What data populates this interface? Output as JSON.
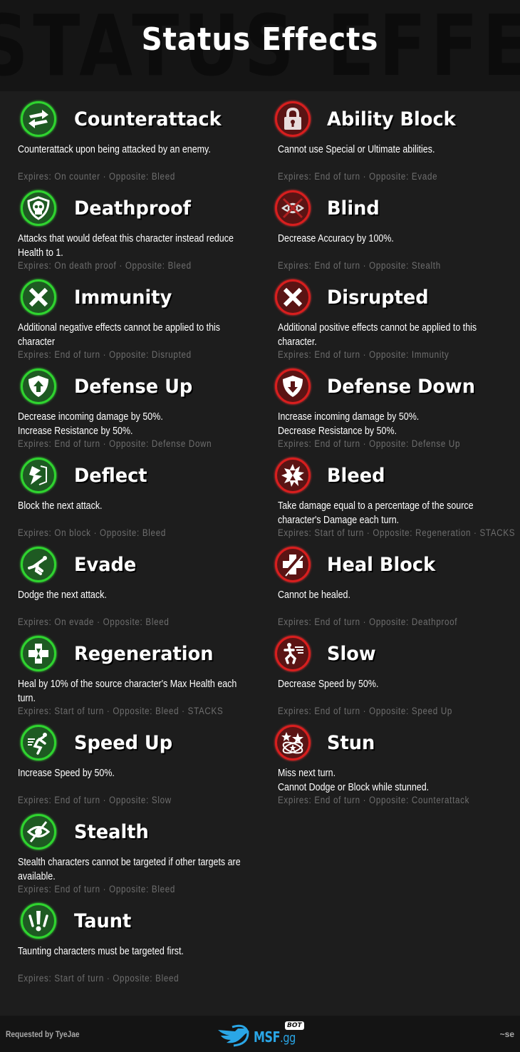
{
  "header": {
    "bg_text": "STATUS EFFECTS",
    "title": "Status Effects"
  },
  "effects_left": [
    {
      "name": "Counterattack",
      "icon": "swap-arrows-icon",
      "type": "buff",
      "description": "Counterattack upon being attacked by an enemy.",
      "meta": "Expires: On counter · Opposite: Bleed"
    },
    {
      "name": "Deathproof",
      "icon": "skull-shield-icon",
      "type": "buff",
      "description": "Attacks that would defeat this character instead reduce\nHealth to 1.",
      "meta": "Expires: On death proof · Opposite: Bleed"
    },
    {
      "name": "Immunity",
      "icon": "x-icon",
      "type": "buff",
      "description": "Additional negative effects cannot be applied to this\ncharacter",
      "meta": "Expires: End of turn · Opposite: Disrupted"
    },
    {
      "name": "Defense Up",
      "icon": "shield-up-icon",
      "type": "buff",
      "description": "Decrease incoming damage by 50%.\nIncrease Resistance by 50%.",
      "meta": "Expires: End of turn · Opposite: Defense Down"
    },
    {
      "name": "Deflect",
      "icon": "deflect-icon",
      "type": "buff",
      "description": "Block the next attack.",
      "meta": "Expires: On block · Opposite: Bleed"
    },
    {
      "name": "Evade",
      "icon": "evade-figure-icon",
      "type": "buff",
      "description": "Dodge the next attack.",
      "meta": "Expires: On evade · Opposite: Bleed"
    },
    {
      "name": "Regeneration",
      "icon": "cross-hourglass-icon",
      "type": "buff",
      "description": "Heal by 10% of the source character's Max Health each\nturn.",
      "meta": "Expires: Start of turn · Opposite: Bleed · STACKS"
    },
    {
      "name": "Speed Up",
      "icon": "running-figure-icon",
      "type": "buff",
      "description": "Increase Speed by 50%.",
      "meta": "Expires: End of turn · Opposite: Slow"
    },
    {
      "name": "Stealth",
      "icon": "eye-slash-icon",
      "type": "buff",
      "description": "Stealth characters cannot be targeted if other targets are\navailable.",
      "meta": "Expires: End of turn · Opposite: Bleed"
    },
    {
      "name": "Taunt",
      "icon": "exclamation-icon",
      "type": "buff",
      "description": "Taunting characters must be targeted first.",
      "meta": "Expires: Start of turn · Opposite: Bleed"
    }
  ],
  "effects_right": [
    {
      "name": "Ability Block",
      "icon": "padlock-icon",
      "type": "debuff",
      "description": "Cannot use Special or Ultimate abilities.",
      "meta": "Expires: End of turn · Opposite: Evade"
    },
    {
      "name": "Blind",
      "icon": "crossed-eye-icon",
      "type": "debuff",
      "description": "Decrease Accuracy by 100%.",
      "meta": "Expires: End of turn · Opposite: Stealth"
    },
    {
      "name": "Disrupted",
      "icon": "x-icon",
      "type": "debuff",
      "description": "Additional positive effects cannot be applied to this\ncharacter.",
      "meta": "Expires: End of turn · Opposite: Immunity"
    },
    {
      "name": "Defense Down",
      "icon": "shield-down-icon",
      "type": "debuff",
      "description": "Increase incoming damage by 50%.\nDecrease Resistance by 50%.",
      "meta": "Expires: End of turn · Opposite: Defense Up"
    },
    {
      "name": "Bleed",
      "icon": "burst-hourglass-icon",
      "type": "debuff",
      "description": "Take damage equal to a percentage of the source\ncharacter's Damage each turn.",
      "meta": "Expires: Start of turn · Opposite: Regeneration · STACKS"
    },
    {
      "name": "Heal Block",
      "icon": "crossed-cross-icon",
      "type": "debuff",
      "description": "Cannot be healed.",
      "meta": "Expires: End of turn · Opposite: Deathproof"
    },
    {
      "name": "Slow",
      "icon": "slow-figure-icon",
      "type": "debuff",
      "description": "Decrease Speed by 50%.",
      "meta": "Expires: End of turn · Opposite: Speed Up"
    },
    {
      "name": "Stun",
      "icon": "stars-orbit-icon",
      "type": "debuff",
      "description": "Miss next turn.\nCannot Dodge or Block while stunned.",
      "meta": "Expires: End of turn · Opposite: Counterattack"
    }
  ],
  "footer": {
    "requested_by": "Requested by TyeJae",
    "logo_text": "MSF",
    "logo_suffix": ".gg",
    "logo_badge": "BOT",
    "signature": "~se"
  },
  "colors": {
    "buff_fill": "#1e5a22",
    "buff_ring": "#2fd42f",
    "debuff_fill": "#5a1414",
    "debuff_ring": "#d81e1e",
    "logo_blue": "#2aa6e6"
  }
}
